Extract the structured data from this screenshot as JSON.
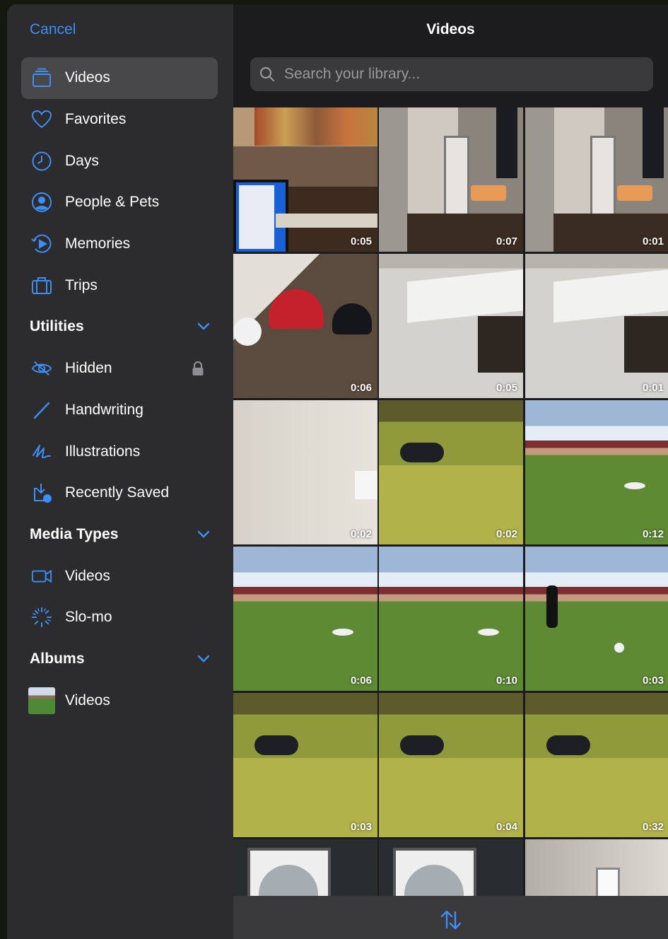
{
  "sidebar": {
    "cancel_label": "Cancel",
    "items_top": [
      {
        "label": "Videos",
        "icon": "stack-icon",
        "selected": true
      },
      {
        "label": "Favorites",
        "icon": "heart-icon"
      },
      {
        "label": "Days",
        "icon": "clock-icon"
      },
      {
        "label": "People & Pets",
        "icon": "person-circle-icon"
      },
      {
        "label": "Memories",
        "icon": "memories-play-icon"
      },
      {
        "label": "Trips",
        "icon": "suitcase-icon"
      }
    ],
    "utilities": {
      "label": "Utilities",
      "items": [
        {
          "label": "Hidden",
          "icon": "eye-slash-icon",
          "locked": true
        },
        {
          "label": "Handwriting",
          "icon": "pen-icon"
        },
        {
          "label": "Illustrations",
          "icon": "scribble-icon"
        },
        {
          "label": "Recently Saved",
          "icon": "download-icon"
        }
      ]
    },
    "media_types": {
      "label": "Media Types",
      "items": [
        {
          "label": "Videos",
          "icon": "video-camera-icon"
        },
        {
          "label": "Slo-mo",
          "icon": "slomo-icon"
        }
      ]
    },
    "albums": {
      "label": "Albums",
      "items": [
        {
          "label": "Videos",
          "icon": "album-thumbnail"
        }
      ]
    }
  },
  "main": {
    "title": "Videos",
    "search_placeholder": "Search your library...",
    "durations": [
      "0:05",
      "0:07",
      "0:01",
      "0:06",
      "0:05",
      "0:01",
      "0:02",
      "0:02",
      "0:12",
      "0:06",
      "0:10",
      "0:03",
      "0:03",
      "0:04",
      "0:32"
    ]
  },
  "colors": {
    "accent": "#3d8ef7",
    "sidebar_bg": "#2c2c2e",
    "selected_bg": "#48484a",
    "main_bg": "#1c1c1e"
  }
}
